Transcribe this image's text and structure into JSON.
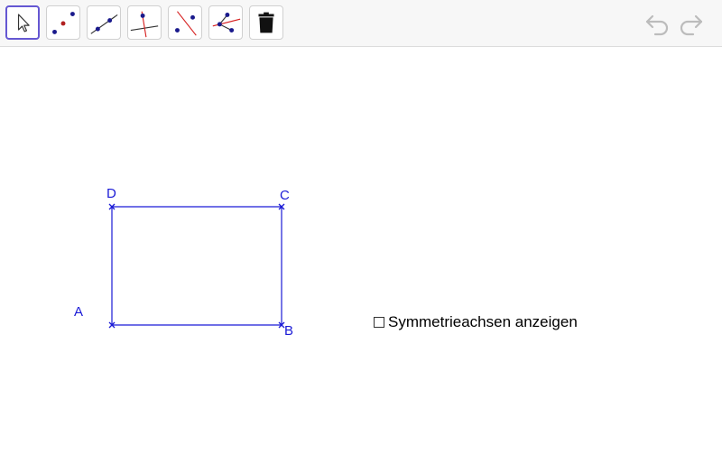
{
  "toolbar": {
    "tools": [
      {
        "name": "move-tool-icon",
        "selected": true
      },
      {
        "name": "point-tool-icon"
      },
      {
        "name": "segment-tool-icon"
      },
      {
        "name": "perpendicular-line-tool-icon"
      },
      {
        "name": "perpendicular-bisector-tool-icon"
      },
      {
        "name": "angle-bisector-tool-icon"
      },
      {
        "name": "delete-tool-icon"
      }
    ],
    "undo_icon": "undo-icon",
    "redo_icon": "redo-icon"
  },
  "graphics": {
    "points": {
      "A": {
        "label": "A"
      },
      "B": {
        "label": "B"
      },
      "C": {
        "label": "C"
      },
      "D": {
        "label": "D"
      }
    },
    "color": "#1a1ad6"
  },
  "checkbox": {
    "label": "Symmetrieachsen anzeigen",
    "checked": false
  },
  "colors": {
    "accent": "#6557d2",
    "toolbar_bg": "#f7f7f7",
    "shape": "#1a1ad6",
    "construction_red": "#d62020"
  }
}
